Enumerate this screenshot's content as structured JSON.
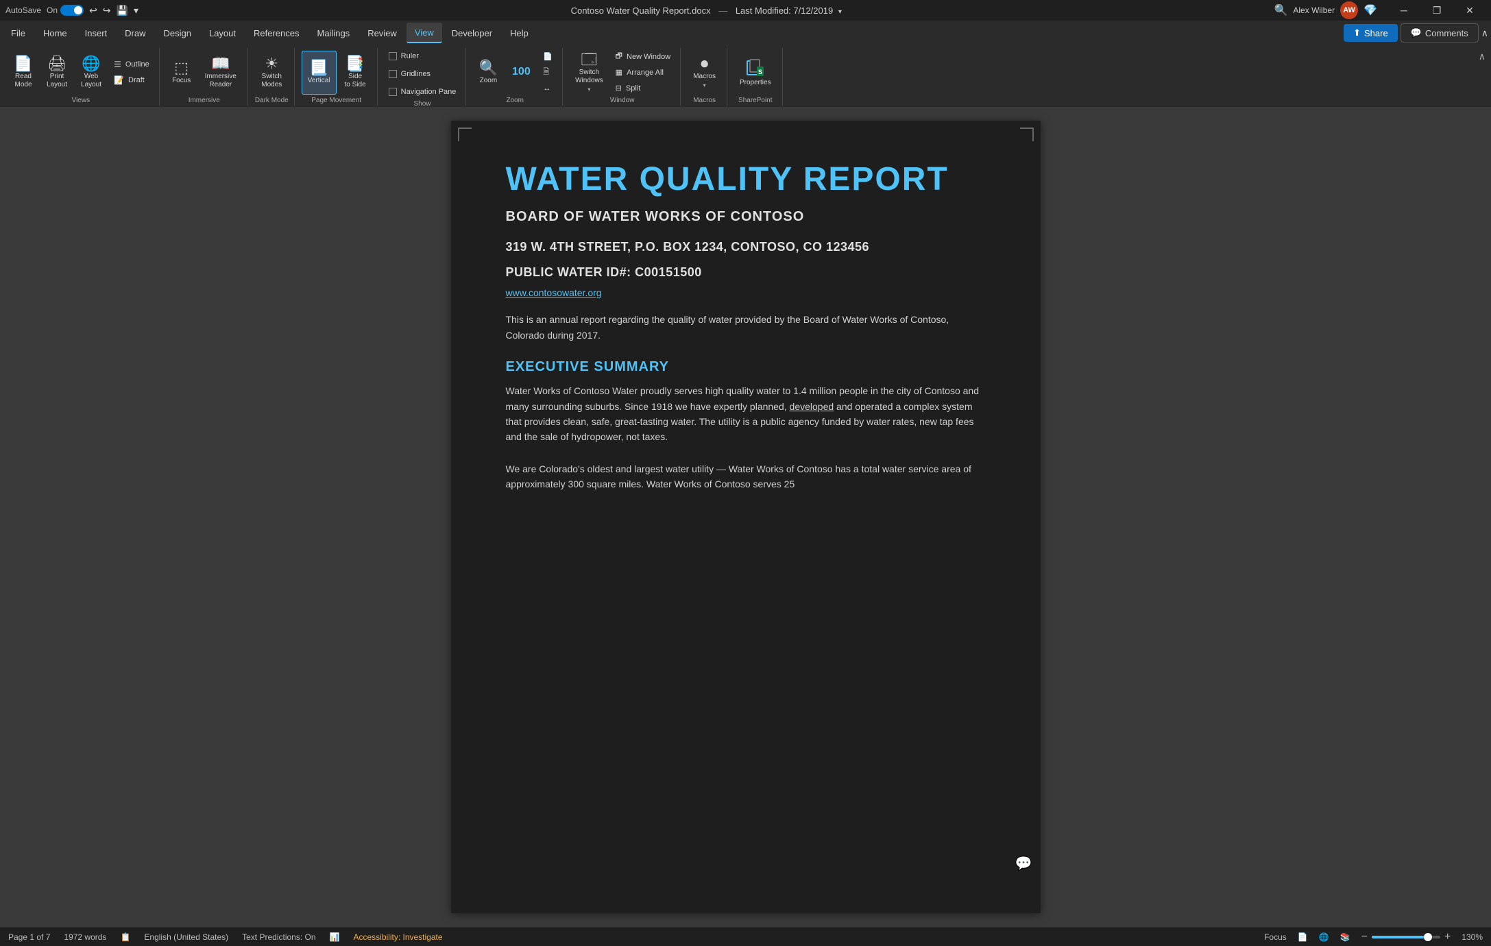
{
  "titlebar": {
    "autosave_label": "AutoSave",
    "toggle_state": "On",
    "file_name": "Contoso Water Quality Report.docx",
    "last_modified_label": "Last Modified: 7/12/2019",
    "user_name": "Alex Wilber",
    "user_initials": "AW",
    "minimize_icon": "─",
    "restore_icon": "❐",
    "close_icon": "✕"
  },
  "menu": {
    "items": [
      {
        "label": "File",
        "active": false
      },
      {
        "label": "Home",
        "active": false
      },
      {
        "label": "Insert",
        "active": false
      },
      {
        "label": "Draw",
        "active": false
      },
      {
        "label": "Design",
        "active": false
      },
      {
        "label": "Layout",
        "active": false
      },
      {
        "label": "References",
        "active": false
      },
      {
        "label": "Mailings",
        "active": false
      },
      {
        "label": "Review",
        "active": false
      },
      {
        "label": "View",
        "active": true
      },
      {
        "label": "Developer",
        "active": false
      },
      {
        "label": "Help",
        "active": false
      }
    ],
    "share_label": "Share",
    "comments_label": "Comments"
  },
  "ribbon": {
    "groups": [
      {
        "name": "Views",
        "label": "Views",
        "buttons": [
          {
            "id": "read-mode",
            "icon": "📄",
            "label": "Read\nMode"
          },
          {
            "id": "print-layout",
            "icon": "🖨",
            "label": "Print\nLayout",
            "active": false
          },
          {
            "id": "web-layout",
            "icon": "🌐",
            "label": "Web\nLayout"
          }
        ],
        "small_buttons": [
          {
            "id": "outline",
            "label": "Outline"
          },
          {
            "id": "draft",
            "label": "Draft"
          }
        ]
      },
      {
        "name": "Immersive",
        "label": "Immersive",
        "buttons": [
          {
            "id": "focus",
            "icon": "⬚",
            "label": "Focus"
          },
          {
            "id": "immersive-reader",
            "icon": "📖",
            "label": "Immersive\nReader"
          }
        ]
      },
      {
        "name": "DarkMode",
        "label": "Dark Mode",
        "buttons": [
          {
            "id": "switch-modes",
            "icon": "☀",
            "label": "Switch\nModes"
          }
        ]
      },
      {
        "name": "PageMovement",
        "label": "Page Movement",
        "buttons": [
          {
            "id": "vertical",
            "icon": "📃",
            "label": "Vertical",
            "active": true
          },
          {
            "id": "side-to-side",
            "icon": "📑",
            "label": "Side\nto Side"
          }
        ]
      },
      {
        "name": "Show",
        "label": "Show",
        "checkboxes": [
          {
            "id": "ruler",
            "label": "Ruler",
            "checked": false
          },
          {
            "id": "gridlines",
            "label": "Gridlines",
            "checked": false
          },
          {
            "id": "navigation-pane",
            "label": "Navigation Pane",
            "checked": false
          }
        ]
      },
      {
        "name": "Zoom",
        "label": "Zoom",
        "zoom_icon": "🔍",
        "zoom_percent": "100%",
        "has_page_btn": true
      },
      {
        "name": "Window",
        "label": "Window",
        "buttons": [
          {
            "id": "new-window",
            "icon": "🗗",
            "label": "New Window"
          },
          {
            "id": "arrange-all",
            "icon": "▦",
            "label": "Arrange All"
          },
          {
            "id": "split",
            "icon": "⬒",
            "label": "Split"
          }
        ],
        "switch_windows": {
          "id": "switch-windows",
          "icon": "🗔",
          "label": "Switch\nWindows"
        }
      },
      {
        "name": "Macros",
        "label": "Macros",
        "buttons": [
          {
            "id": "macros",
            "icon": "⏺",
            "label": "Macros"
          }
        ]
      },
      {
        "name": "SharePoint",
        "label": "SharePoint",
        "buttons": [
          {
            "id": "properties",
            "icon": "🗂",
            "label": "Properties"
          }
        ]
      }
    ]
  },
  "document": {
    "title": "WATER QUALITY REPORT",
    "subtitle": "BOARD OF WATER WORKS OF CONTOSO",
    "address_line1": "319 W. 4TH STREET, P.O. BOX 1234, CONTOSO, CO 123456",
    "address_line2": "PUBLIC WATER ID#: C00151500",
    "website": "www.contosowater.org",
    "intro": "This is an annual report regarding the quality of water provided by the Board of Water Works of Contoso, Colorado during 2017.",
    "section1_title": "EXECUTIVE SUMMARY",
    "section1_para1": "Water Works of Contoso Water proudly serves high quality water to 1.4 million people in the city of Contoso and many surrounding suburbs. Since 1918 we have expertly planned, developed and operated a complex system that provides clean, safe, great-tasting water. The utility is a public agency funded by water rates, new tap fees and the sale of hydropower, not taxes.",
    "section1_para1_underline": "developed",
    "section1_para2": "We are Colorado's oldest and largest water utility — Water Works of Contoso has a total water service area of approximately 300 square miles. Water Works of Contoso serves 25"
  },
  "statusbar": {
    "page_info": "Page 1 of 7",
    "word_count": "1972 words",
    "language": "English (United States)",
    "text_predictions": "Text Predictions: On",
    "accessibility": "Accessibility: Investigate",
    "focus_label": "Focus",
    "zoom_percent": "130%",
    "zoom_minus": "−",
    "zoom_plus": "+"
  }
}
